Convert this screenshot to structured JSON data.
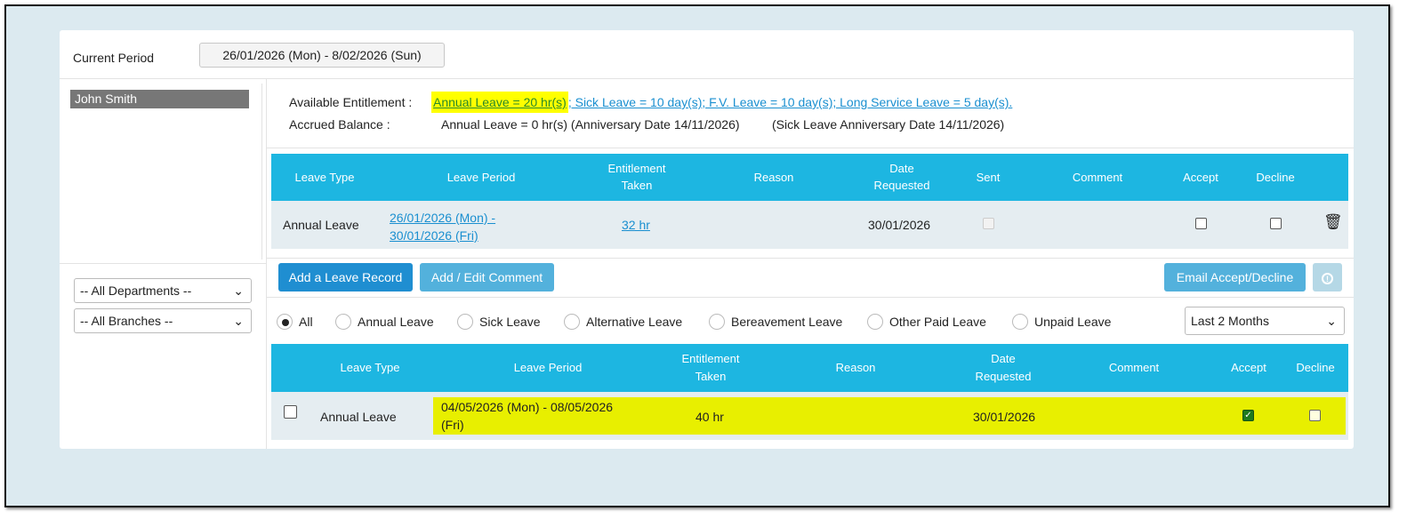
{
  "header": {
    "period_label": "Current Period",
    "period_value": "26/01/2026 (Mon) - 8/02/2026 (Sun)"
  },
  "employees": [
    {
      "name": "John Smith"
    }
  ],
  "filters": {
    "department": "-- All Departments --",
    "branch": "-- All Branches --"
  },
  "entitlement": {
    "available_label": "Available Entitlement :",
    "annual": "Annual Leave = 20 hr(s)",
    "others": "; Sick Leave = 10 day(s); F.V. Leave = 10 day(s); Long Service Leave = 5 day(s).",
    "accrued_label": "Accrued Balance :",
    "accrued_value": "Annual Leave = 0 hr(s) (Anniversary Date 14/11/2026)",
    "sick_anniv": "(Sick Leave Anniversary Date 14/11/2026)"
  },
  "pending_table": {
    "headers": [
      "Leave Type",
      "Leave Period",
      "Entitlement",
      "Taken",
      "Reason",
      "Date",
      "Requested",
      "Sent",
      "Comment",
      "Accept",
      "Decline"
    ],
    "rows": [
      {
        "leave_type": "Annual Leave",
        "period_line1": "26/01/2026 (Mon) -",
        "period_line2": "30/01/2026 (Fri)",
        "taken": "32 hr",
        "reason": "",
        "date_requested": "30/01/2026",
        "sent": false,
        "comment": "",
        "accept": false,
        "decline": false
      }
    ]
  },
  "buttons": {
    "add_record": "Add a Leave Record",
    "add_comment": "Add / Edit Comment",
    "email": "Email Accept/Decline"
  },
  "leave_filters": [
    "All",
    "Annual Leave",
    "Sick Leave",
    "Alternative Leave",
    "Bereavement Leave",
    "Other Paid Leave",
    "Unpaid Leave"
  ],
  "selected_filter": "All",
  "range": "Last 2 Months",
  "history_table": {
    "headers": [
      "Leave Type",
      "Leave Period",
      "Entitlement",
      "Taken",
      "Reason",
      "Date",
      "Requested",
      "Comment",
      "Accept",
      "Decline"
    ],
    "rows": [
      {
        "leave_type": "Annual Leave",
        "period_line1": "04/05/2026 (Mon) - 08/05/2026",
        "period_line2": "(Fri)",
        "taken": "40 hr",
        "reason": "",
        "date_requested": "30/01/2026",
        "comment": "",
        "accept": true,
        "decline": false
      }
    ]
  },
  "colors": {
    "accent": "#1db6e1",
    "highlight": "#e8ef00",
    "button": "#1f8ed1"
  }
}
